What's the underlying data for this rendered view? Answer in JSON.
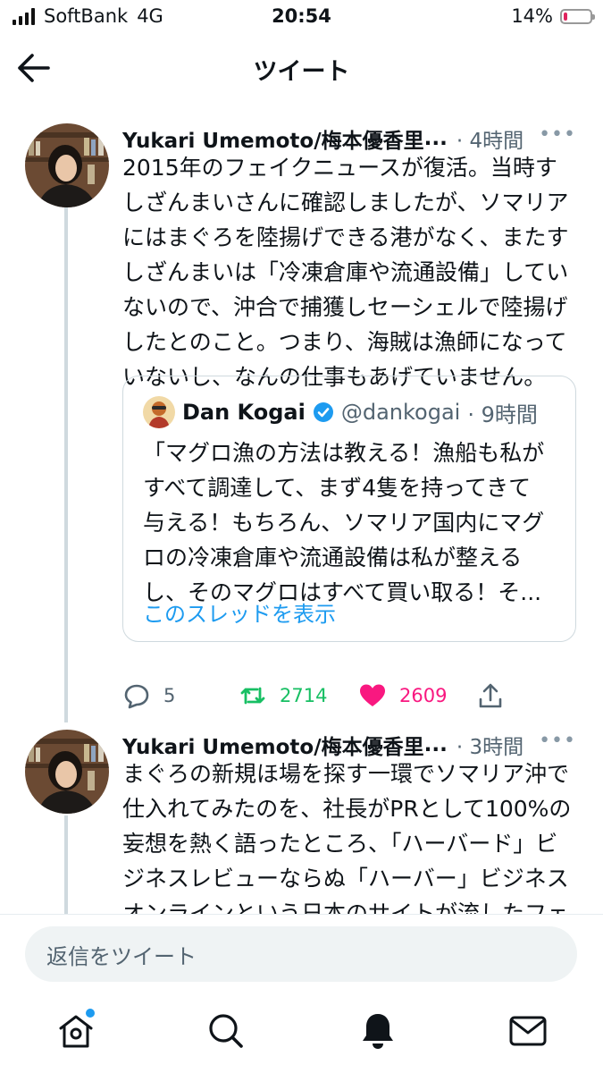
{
  "status_bar": {
    "carrier": "SoftBank",
    "network": "4G",
    "time": "20:54",
    "battery": "14%",
    "battery_level": 0.14,
    "battery_color": "#e0245e"
  },
  "header": {
    "title": "ツイート",
    "back_icon": "arrow-left-icon"
  },
  "tweets": [
    {
      "author": "Yukari Umemoto/梅本優香里",
      "ellipsis": "...",
      "time_ago": "· 4時間",
      "more": "•••",
      "body_lines": [
        "2015年のフェイクニュースが復活。当時す",
        "しざんまいさんに確認しましたが、ソマリア",
        "にはまぐろを陸揚げできる港がなく、またす",
        "しざんまいは「冷凍倉庫や流通設備」してい",
        "ないので、沖合で捕獲しセーシェルで陸揚げ",
        "したとのこと。つまり、海賊は漁師になって",
        "いないし、なんの仕事もあげていません。"
      ],
      "quote": {
        "name": "Dan Kogai",
        "handle": "@dankogai",
        "time_ago": "· 9時間",
        "body_lines": [
          "「マグロ漁の方法は教える！漁船も私が",
          "すべて調達して、まず4隻を持ってきて",
          "与える！もちろん、ソマリア国内にマグ",
          "ロの冷凍倉庫や流通設備は私が整える",
          "し、そのマグロはすべて買い取る！そ..."
        ],
        "show_thread": "このスレッドを表示"
      },
      "replies": "5",
      "retweets": "2714",
      "likes": "2609",
      "retweet_color": "#17bf63",
      "like_color": "#f91880"
    },
    {
      "author": "Yukari Umemoto/梅本優香里",
      "ellipsis": "...",
      "time_ago": "· 3時間",
      "more": "•••",
      "body_lines": [
        "まぐろの新規ほ場を探す一環でソマリア沖で",
        "仕入れてみたのを、社長がPRとして100%の",
        "妄想を熱く語ったところ、「ハーバード」ビ",
        "ジネスレビューならぬ「ハーバー」ビジネス",
        "オンラインという日本のサイトが流したフェ"
      ]
    }
  ],
  "reply_box": {
    "placeholder": "返信をツイート"
  },
  "tabbar": {
    "items": [
      "home-icon",
      "search-icon",
      "notifications-icon",
      "messages-icon"
    ],
    "accent": "#1d9bf0"
  }
}
